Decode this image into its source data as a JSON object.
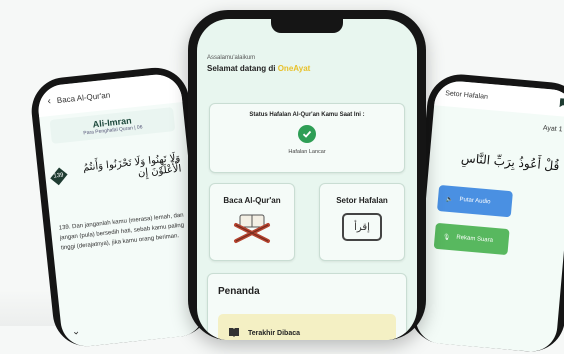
{
  "left_screen": {
    "back_label": "Baca Al-Qur'an",
    "surah_name": "Ali-Imran",
    "surah_sub": "Para Penghafal Quran | 06",
    "ayah_number": "139",
    "arabic_text": "وَلَا تَهِنُوا وَلَا تَحْزَنُوا وَأَنتُمُ الْأَعْلَوْنَ إِن",
    "translation": "139. Dan janganlah kamu (merasa) lemah, dan jangan (pula) bersedih hati, sebab kamu paling tinggi (derajatnya), jika kamu orang beriman."
  },
  "right_screen": {
    "title": "Setor Hafalan",
    "ayat_label": "Ayat 1",
    "arabic_text": "قُلْ أَعُوذُ بِرَبِّ النَّاسِ",
    "play_button": "Putar Audio",
    "record_button": "Rekam Suara"
  },
  "center_screen": {
    "greeting_small": "Assalamu'alaikum",
    "greeting_prefix": "Selamat datang di",
    "greeting_user": "OneAyat",
    "status_title": "Status Hafalan Al-Qur'an Kamu Saat Ini :",
    "status_value": "Hafalan Lancar",
    "baca_label": "Baca Al-Qur'an",
    "baca_icon_text": "إقرأ",
    "setor_label": "Setor Hafalan",
    "penanda_title": "Penanda",
    "last_read_label": "Terakhir Dibaca"
  },
  "colors": {
    "accent_green": "#2e9e55",
    "user_yellow": "#e8c12a",
    "screen_bg": "#e8f6ef",
    "last_read_bg": "#f4f0c4",
    "audio_blue": "#4a90e2",
    "record_green": "#58b85f"
  }
}
